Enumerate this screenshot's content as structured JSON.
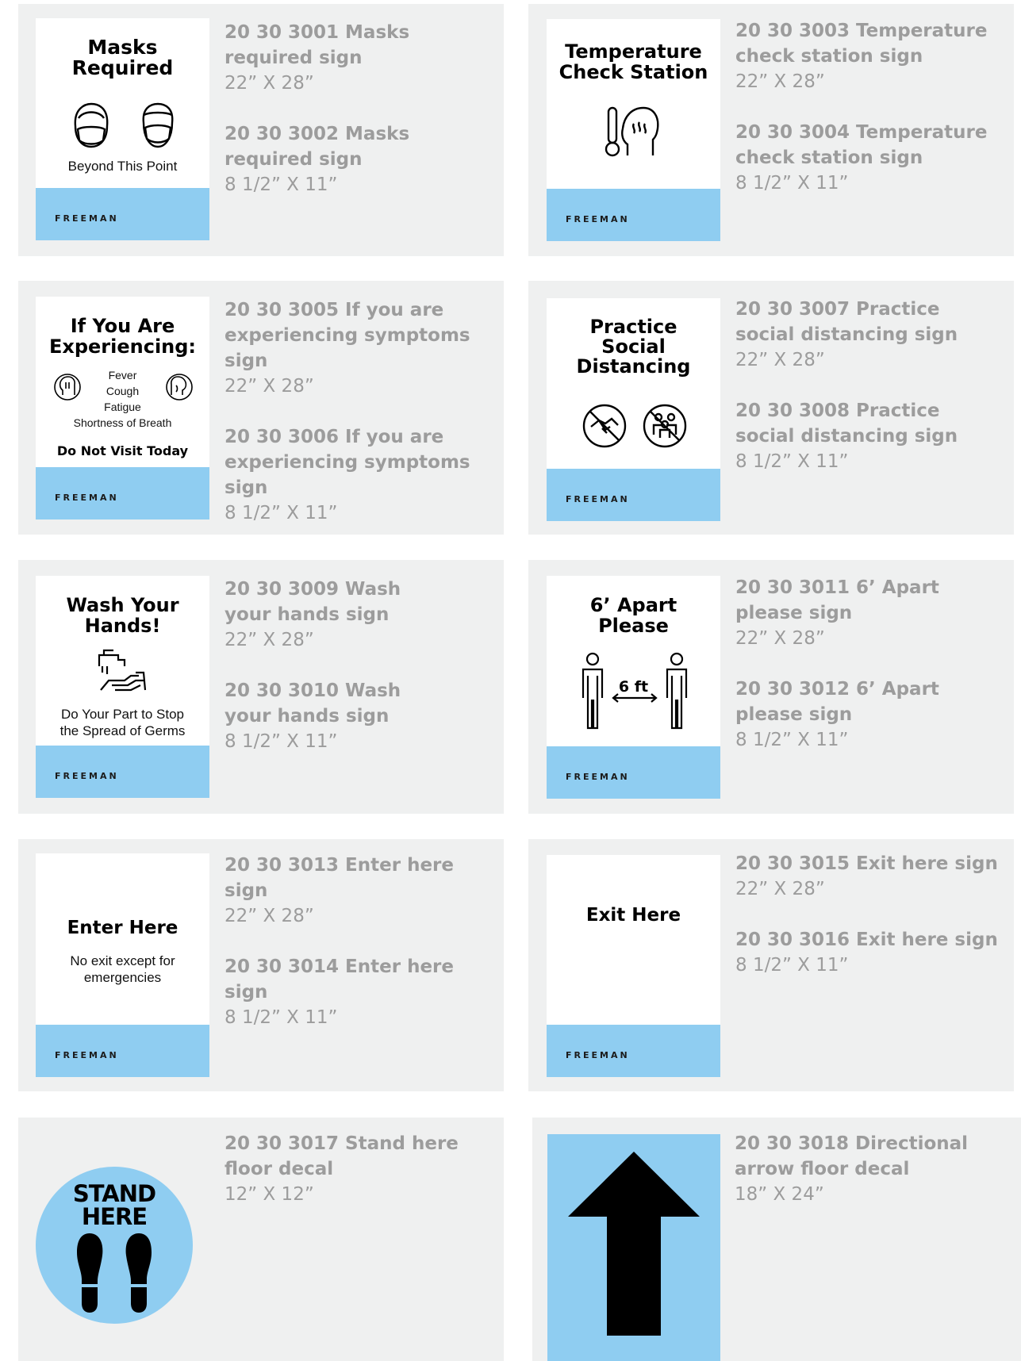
{
  "brand": "FREEMAN",
  "signs": {
    "masks": {
      "title": "Masks\nRequired",
      "subtitle": "Beyond This Point"
    },
    "temperature": {
      "title": "Temperature\nCheck Station"
    },
    "symptoms": {
      "title": "If You Are\nExperiencing:",
      "list": [
        "Fever",
        "Cough",
        "Fatigue",
        "Shortness of Breath"
      ],
      "footer": "Do Not Visit Today"
    },
    "distancing": {
      "title": "Practice\nSocial\nDistancing"
    },
    "wash": {
      "title": "Wash Your\nHands!",
      "subtitle": "Do Your Part to Stop\nthe Spread of Germs"
    },
    "apart": {
      "title": "6’ Apart\nPlease",
      "distance": "6 ft"
    },
    "enter": {
      "title": "Enter Here",
      "subtitle": "No exit except for\nemergencies"
    },
    "exit": {
      "title": "Exit Here"
    },
    "stand": {
      "title": "STAND\nHERE"
    }
  },
  "products": {
    "masks": [
      {
        "name": "20 30 3001 Masks\nrequired sign",
        "size": "22” X 28”"
      },
      {
        "name": "20 30 3002 Masks\nrequired sign",
        "size": "8 1/2” X 11”"
      }
    ],
    "temperature": [
      {
        "name": "20 30 3003 Temperature\ncheck station sign",
        "size": "22” X 28”"
      },
      {
        "name": "20 30 3004 Temperature\ncheck station sign",
        "size": "8 1/2” X 11”"
      }
    ],
    "symptoms": [
      {
        "name": "20 30 3005 If you are\nexperiencing symptoms sign",
        "size": "22” X 28”"
      },
      {
        "name": "20 30 3006 If you are\nexperiencing symptoms sign",
        "size": "8 1/2” X 11”"
      }
    ],
    "distancing": [
      {
        "name": "20 30 3007 Practice\nsocial distancing sign",
        "size": "22” X 28”"
      },
      {
        "name": "20 30 3008 Practice\nsocial distancing sign",
        "size": "8 1/2” X 11”"
      }
    ],
    "wash": [
      {
        "name": "20 30 3009 Wash\nyour hands sign",
        "size": "22” X 28”"
      },
      {
        "name": "20 30 3010 Wash\nyour hands sign",
        "size": "8 1/2” X 11”"
      }
    ],
    "apart": [
      {
        "name": "20 30 3011 6’ Apart\nplease sign",
        "size": "22” X 28”"
      },
      {
        "name": "20 30 3012 6’ Apart\nplease sign",
        "size": "8 1/2” X 11”"
      }
    ],
    "enter": [
      {
        "name": "20 30 3013 Enter here sign",
        "size": "22” X 28”"
      },
      {
        "name": "20 30 3014 Enter here sign",
        "size": "8 1/2” X 11”"
      }
    ],
    "exit": [
      {
        "name": "20 30 3015 Exit here sign",
        "size": "22” X 28”"
      },
      {
        "name": "20 30 3016 Exit here sign",
        "size": "8 1/2” X 11”"
      }
    ],
    "stand": [
      {
        "name": "20 30 3017 Stand here\nfloor decal",
        "size": "12” X 12”"
      }
    ],
    "arrow": [
      {
        "name": "20 30 3018 Directional\narrow floor decal",
        "size": "18” X 24”"
      }
    ]
  },
  "icons": {
    "mask_faces": "face-mask-icon",
    "thermometer": "thermometer-head-icon",
    "no_handshake": "no-handshake-icon",
    "no_crowd": "no-crowd-icon",
    "hand_wash": "hand-wash-icon",
    "people_distance": "people-distance-icon",
    "footprints": "footprints-icon",
    "arrow": "arrow-up-icon"
  },
  "colors": {
    "card_bg": "#eff0f0",
    "sign_band": "#8fcdf1",
    "text_gray": "#9c9c9c",
    "ink": "#000000"
  }
}
